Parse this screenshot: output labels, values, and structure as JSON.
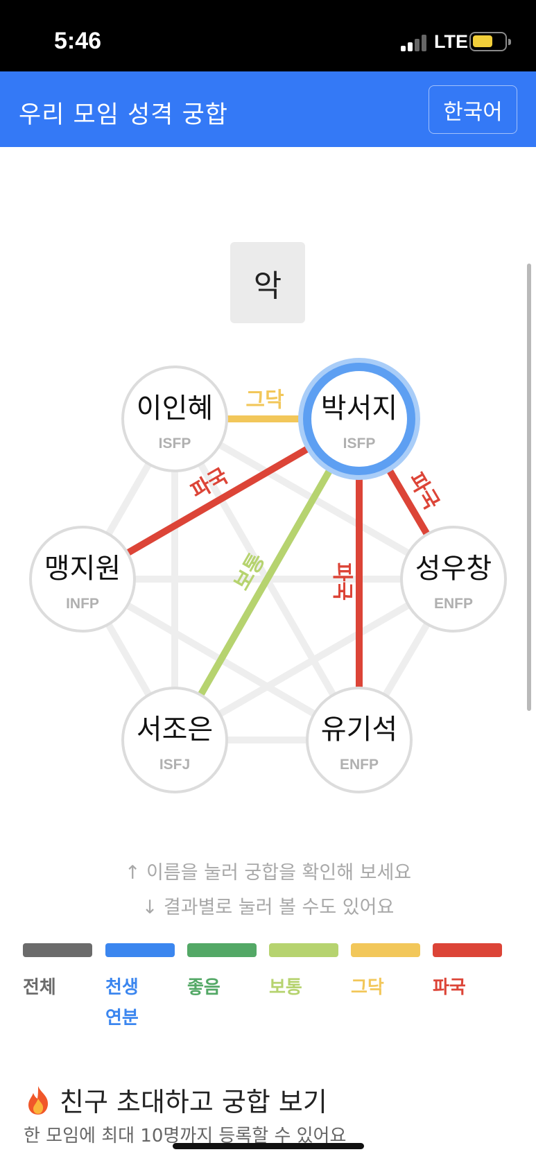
{
  "status_bar": {
    "time": "5:46",
    "network": "LTE"
  },
  "header": {
    "title": "우리 모임 성격 궁합",
    "language_button": "한국어"
  },
  "center_label": "악",
  "nodes": [
    {
      "name": "이인혜",
      "mbti": "ISFP"
    },
    {
      "name": "박서지",
      "mbti": "ISFP"
    },
    {
      "name": "맹지원",
      "mbti": "INFP"
    },
    {
      "name": "성우창",
      "mbti": "ENFP"
    },
    {
      "name": "서조은",
      "mbti": "ISFJ"
    },
    {
      "name": "유기석",
      "mbti": "ENFP"
    }
  ],
  "selected_node": "박서지",
  "edges": [
    {
      "from": "박서지",
      "to": "이인혜",
      "label": "그닥",
      "color": "#f2c75a"
    },
    {
      "from": "박서지",
      "to": "맹지원",
      "label": "파국",
      "color": "#dc4437"
    },
    {
      "from": "박서지",
      "to": "서조은",
      "label": "보통",
      "color": "#b6d36f"
    },
    {
      "from": "박서지",
      "to": "유기석",
      "label": "파국",
      "color": "#dc4437"
    },
    {
      "from": "박서지",
      "to": "성우창",
      "label": "파국",
      "color": "#dc4437"
    }
  ],
  "hints": {
    "line1": "↑ 이름을 눌러 궁합을 확인해 보세요",
    "line2": "↓ 결과별로 눌러 볼 수도 있어요"
  },
  "legend": [
    {
      "label": "전체",
      "color": "#6b6b6b"
    },
    {
      "label": "천생\n연분",
      "color": "#3b86ef"
    },
    {
      "label": "좋음",
      "color": "#53a866"
    },
    {
      "label": "보통",
      "color": "#b6d36f"
    },
    {
      "label": "그닥",
      "color": "#f2c75a"
    },
    {
      "label": "파국",
      "color": "#dc4437"
    }
  ],
  "invite": {
    "title": "친구 초대하고 궁합 보기",
    "subtitle": "한 모임에 최대 10명까지 등록할 수 있어요"
  },
  "colors": {
    "accent": "#3479f6",
    "selected_ring": "#5d9ff2",
    "inactive_edge": "#eeeeee"
  }
}
